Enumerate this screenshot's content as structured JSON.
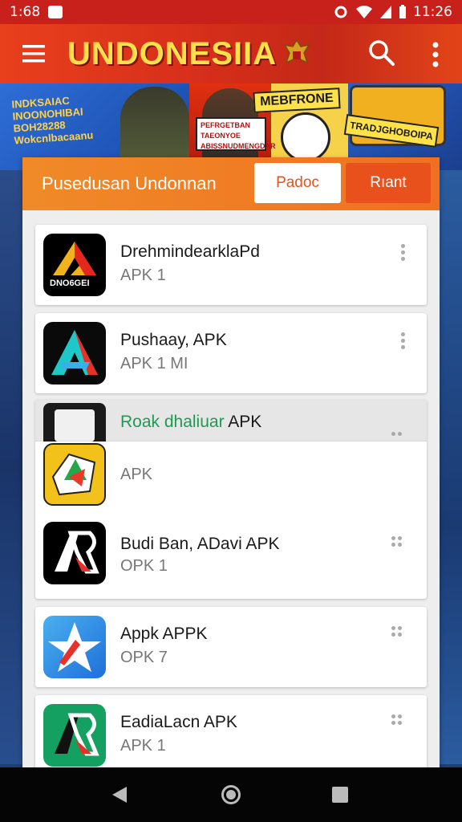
{
  "statusbar": {
    "time": "1:68",
    "time_right": "11:26"
  },
  "appbar": {
    "title": "UNDONESIIA"
  },
  "banner": {
    "left_text": "INDKSAIAC INOONOHIBAI BOH28288 Wokcnlbacaanu",
    "mega_label": "MEBFRONE",
    "caption": "PEFRGETBAN TAEONYOE ABISSNUDMENGDAR",
    "bus_sign": "TRADJGHOBOIPA"
  },
  "panel": {
    "title": "Pusedusan Undonnan",
    "btn_primary": "Padoc",
    "btn_secondary": "Rıant"
  },
  "apps": [
    {
      "name": "DrehmindearklaPd",
      "sub": "APK 1",
      "icon_text": "DNO6GEI"
    },
    {
      "name": "Pushaay, APK",
      "sub": "APK 1 MI"
    },
    {
      "name_green": "Roak dhaliuar",
      "name_rest": "APK"
    },
    {
      "sub": "APK"
    },
    {
      "name": "Budi Ban, ADavi APK",
      "sub": "OPK 1"
    },
    {
      "name": "Appk APPK",
      "sub": "OPK 7"
    },
    {
      "name": "EadiaLacn APK",
      "sub": "APK 1"
    }
  ],
  "colors": {
    "accent": "#e8501c",
    "header_orange": "#f07a24",
    "status_red": "#c8201a",
    "green_text": "#1f9a52"
  }
}
